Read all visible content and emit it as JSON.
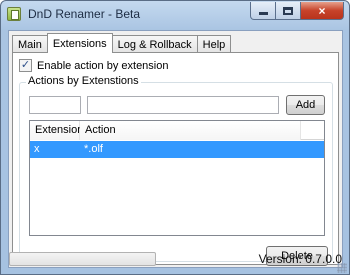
{
  "window": {
    "title": "DnD Renamer - Beta"
  },
  "caption": {
    "minimize_icon": "minimize-icon",
    "maximize_icon": "maximize-icon",
    "close_glyph": "×"
  },
  "tabs": [
    {
      "label": "Main"
    },
    {
      "label": "Extensions",
      "active": true
    },
    {
      "label": "Log & Rollback"
    },
    {
      "label": "Help"
    }
  ],
  "extensions_tab": {
    "enable_checkbox": {
      "label": "Enable action by extension",
      "checked": true,
      "check_glyph": "✓"
    },
    "group_label": "Actions by Extenstions",
    "extension_input": {
      "value": ""
    },
    "action_input": {
      "value": ""
    },
    "add_label": "Add",
    "list": {
      "columns": [
        "Extension",
        "Action"
      ],
      "rows": [
        {
          "extension": "x",
          "action": "*.olf",
          "selected": true
        }
      ]
    },
    "delete_label": "Delete"
  },
  "status": {
    "version": "Version: 0.7.0.0",
    "progress": 0
  },
  "colors": {
    "selection": "#3399ff",
    "close_button": "#c7432a"
  }
}
